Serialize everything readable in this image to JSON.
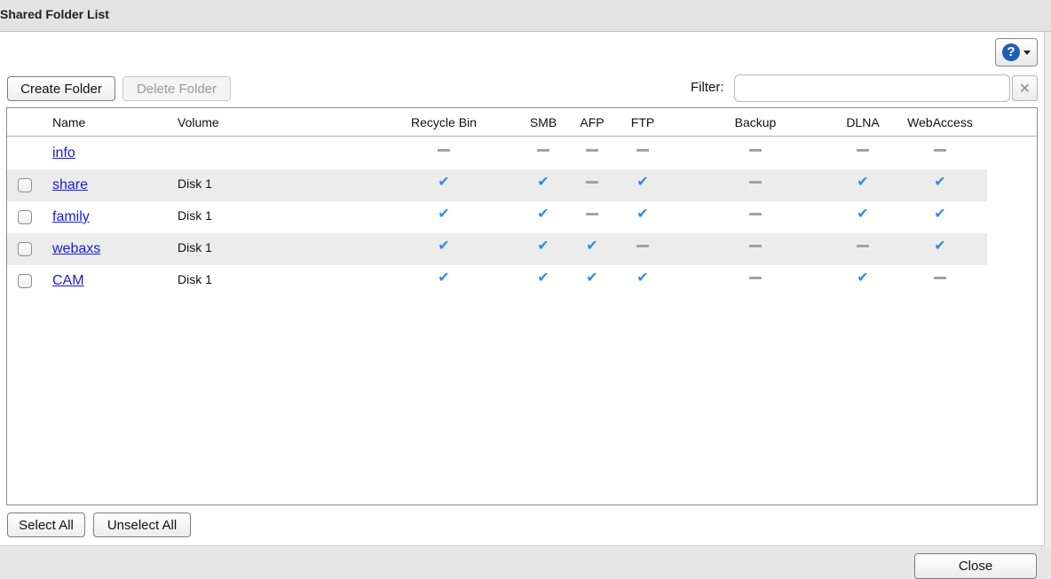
{
  "window": {
    "title": "Shared Folder List"
  },
  "toolbar": {
    "create_label": "Create Folder",
    "delete_label": "Delete Folder",
    "filter_label": "Filter:",
    "filter_value": "",
    "filter_clear_icon": "clear-x-icon",
    "help_icon": "question-icon"
  },
  "columns": {
    "name": "Name",
    "volume": "Volume",
    "recycle": "Recycle Bin",
    "smb": "SMB",
    "afp": "AFP",
    "ftp": "FTP",
    "backup": "Backup",
    "dlna": "DLNA",
    "webaccess": "WebAccess"
  },
  "rows": [
    {
      "name": "info",
      "volume": "",
      "checkbox": false,
      "recycle": false,
      "smb": false,
      "afp": false,
      "ftp": false,
      "backup": false,
      "dlna": false,
      "webaccess": false
    },
    {
      "name": "share",
      "volume": "Disk 1",
      "checkbox": true,
      "recycle": true,
      "smb": true,
      "afp": false,
      "ftp": true,
      "backup": false,
      "dlna": true,
      "webaccess": true
    },
    {
      "name": "family",
      "volume": "Disk 1",
      "checkbox": true,
      "recycle": true,
      "smb": true,
      "afp": false,
      "ftp": true,
      "backup": false,
      "dlna": true,
      "webaccess": true
    },
    {
      "name": "webaxs",
      "volume": "Disk 1",
      "checkbox": true,
      "recycle": true,
      "smb": true,
      "afp": true,
      "ftp": false,
      "backup": false,
      "dlna": false,
      "webaccess": true
    },
    {
      "name": "CAM",
      "volume": "Disk 1",
      "checkbox": true,
      "recycle": true,
      "smb": true,
      "afp": true,
      "ftp": true,
      "backup": false,
      "dlna": true,
      "webaccess": false
    }
  ],
  "selection": {
    "select_all_label": "Select All",
    "unselect_all_label": "Unselect All"
  },
  "footer": {
    "close_label": "Close"
  },
  "colors": {
    "check": "#2d8ee6",
    "link": "#1a1ad6",
    "dash": "#a3a3a3",
    "alt_row": "#ececec"
  }
}
